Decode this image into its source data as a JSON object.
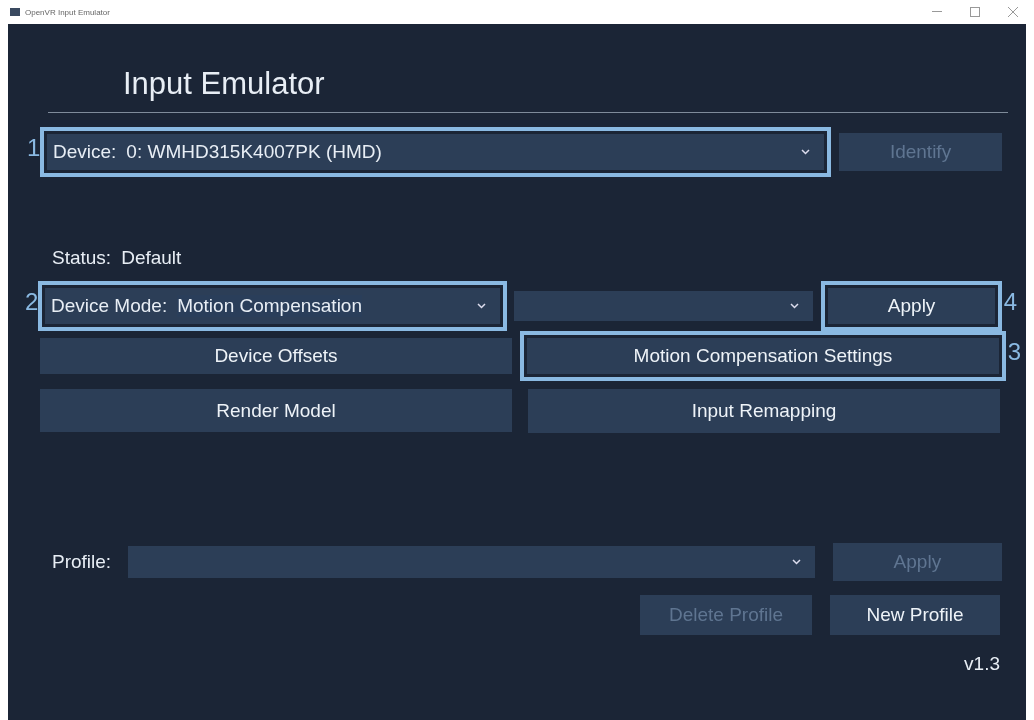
{
  "window": {
    "title": "OpenVR Input Emulator"
  },
  "heading": "Input Emulator",
  "device": {
    "label": "Device:",
    "value": "0: WMHD315K4007PK (HMD)",
    "callout": "1"
  },
  "identify_button": {
    "label": "Identify",
    "disabled": true
  },
  "status": {
    "label": "Status:",
    "value": "Default"
  },
  "device_mode": {
    "label": "Device Mode:",
    "value": "Motion Compensation",
    "callout": "2"
  },
  "apply_button": {
    "label": "Apply",
    "disabled": false,
    "callout": "4"
  },
  "buttons": [
    {
      "label": "Device Offsets",
      "disabled": false
    },
    {
      "label": "Motion Compensation Settings",
      "disabled": false,
      "callout": "3"
    },
    {
      "label": "Render Model",
      "disabled": false
    },
    {
      "label": "Input Remapping",
      "disabled": false
    }
  ],
  "profile": {
    "label": "Profile:"
  },
  "profile_apply": {
    "label": "Apply",
    "disabled": true
  },
  "delete_profile": {
    "label": "Delete Profile",
    "disabled": true
  },
  "new_profile": {
    "label": "New Profile",
    "disabled": false
  },
  "version": "v1.3"
}
